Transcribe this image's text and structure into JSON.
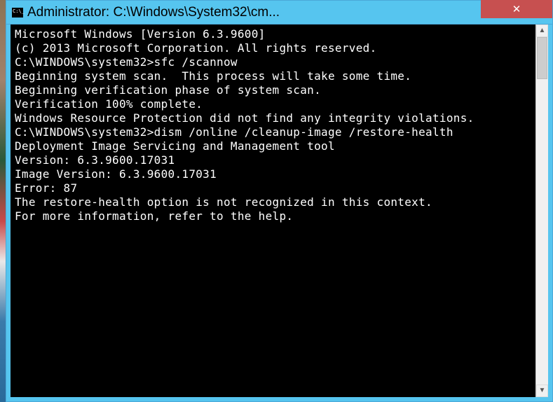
{
  "window": {
    "title": "Administrator: C:\\Windows\\System32\\cm...",
    "close_label": "✕"
  },
  "console": {
    "lines": [
      "Microsoft Windows [Version 6.3.9600]",
      "(c) 2013 Microsoft Corporation. All rights reserved.",
      "",
      "C:\\WINDOWS\\system32>sfc /scannow",
      "",
      "Beginning system scan.  This process will take some time.",
      "",
      "Beginning verification phase of system scan.",
      "Verification 100% complete.",
      "",
      "Windows Resource Protection did not find any integrity violations.",
      "",
      "C:\\WINDOWS\\system32>dism /online /cleanup-image /restore-health",
      "",
      "Deployment Image Servicing and Management tool",
      "Version: 6.3.9600.17031",
      "",
      "Image Version: 6.3.9600.17031",
      "",
      "",
      "Error: 87",
      "",
      "The restore-health option is not recognized in this context.",
      "For more information, refer to the help."
    ]
  },
  "scroll": {
    "up_arrow": "▲",
    "down_arrow": "▼"
  }
}
